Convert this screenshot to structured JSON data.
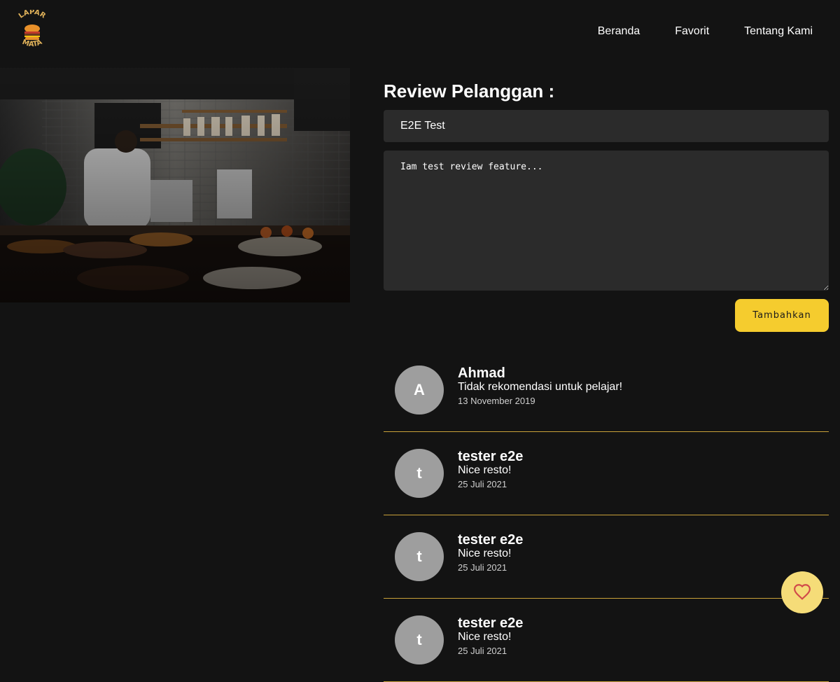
{
  "nav": {
    "items": [
      "Beranda",
      "Favorit",
      "Tentang Kami"
    ],
    "logo_text_top": "LAPAR",
    "logo_text_bottom": "MATA"
  },
  "review_form": {
    "title": "Review Pelanggan :",
    "name_value": "E2E Test",
    "review_value": "Iam test review feature...",
    "submit_label": "Tambahkan"
  },
  "reviews": [
    {
      "initial": "A",
      "name": "Ahmad",
      "text": "Tidak rekomendasi untuk pelajar!",
      "date": "13 November 2019"
    },
    {
      "initial": "t",
      "name": "tester e2e",
      "text": "Nice resto!",
      "date": "25 Juli 2021"
    },
    {
      "initial": "t",
      "name": "tester e2e",
      "text": "Nice resto!",
      "date": "25 Juli 2021"
    },
    {
      "initial": "t",
      "name": "tester e2e",
      "text": "Nice resto!",
      "date": "25 Juli 2021"
    }
  ],
  "colors": {
    "background": "#131313",
    "accent": "#f5cc2e",
    "fab": "#f5dc78",
    "divider": "#c9a13a",
    "heart": "#d14a4a"
  },
  "icons": {
    "fab": "heart-outline-icon"
  }
}
